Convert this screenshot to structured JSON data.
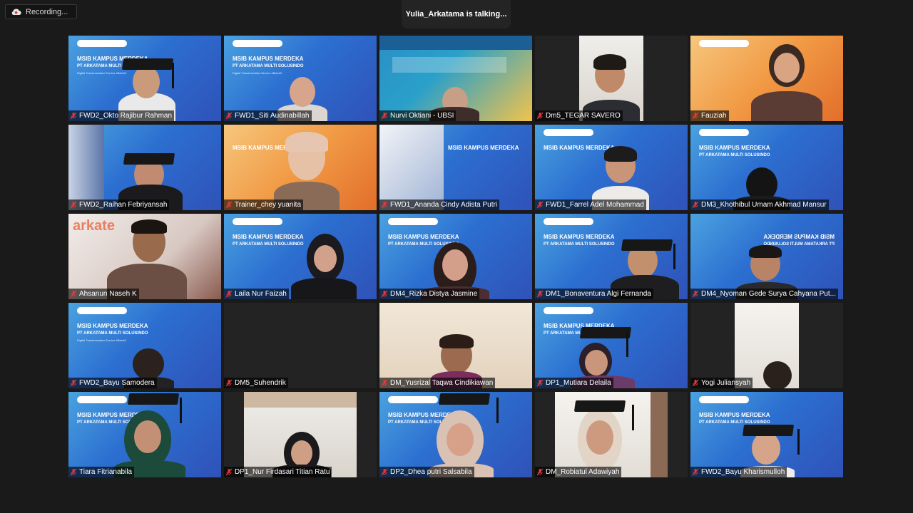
{
  "recording": {
    "label": "Recording..."
  },
  "active_speaker": {
    "text": "Yulia_Arkatama is talking..."
  },
  "colors": {
    "muted_mic": "#e8383d",
    "background": "#1a1a1a"
  },
  "slide": {
    "line1": "MSIB KAMPUS MERDEKA",
    "line2": "PT ARKATAMA MULTI SOLUSINDO",
    "line3": "Digital Transformation Service #Batch2"
  },
  "participants": [
    {
      "name": "FWD2_Okto Rajibur Rahman",
      "bg": "msib"
    },
    {
      "name": "FWD1_Siti Audinabillah",
      "bg": "msib"
    },
    {
      "name": "Nurvi Oktiani - UBSI",
      "bg": "teal"
    },
    {
      "name": "Dm5_TEGAR SAVERO",
      "bg": "dark"
    },
    {
      "name": "Fauziah",
      "bg": "orange"
    },
    {
      "name": "FWD2_Raihan Febriyansah",
      "bg": "msib"
    },
    {
      "name": "Trainer_chey yuanita",
      "bg": "orange"
    },
    {
      "name": "FWD1_Ananda Cindy Adista Putri",
      "bg": "msib"
    },
    {
      "name": "FWD1_Farrel Adel Mohammad",
      "bg": "msib"
    },
    {
      "name": "DM3_Khothibul Umam Akhmad Mansur",
      "bg": "msib"
    },
    {
      "name": "Ahsanun Naseh K",
      "bg": "office"
    },
    {
      "name": "Laila Nur Faizah",
      "bg": "msib"
    },
    {
      "name": "DM4_Rizka Distya Jasmine",
      "bg": "msib"
    },
    {
      "name": "DM1_Bonaventura Algi Fernanda",
      "bg": "msib"
    },
    {
      "name": "DM4_Nyoman Gede Surya Cahyana Put...",
      "bg": "msib"
    },
    {
      "name": "FWD2_Bayu Samodera",
      "bg": "msib"
    },
    {
      "name": "DM5_Suhendrik",
      "bg": "dark"
    },
    {
      "name": "DM_Yusrizal Taqwa Cindikiawan",
      "bg": "warm"
    },
    {
      "name": "DP1_Mutiara Delaila",
      "bg": "msib"
    },
    {
      "name": "Yogi Juliansyah",
      "bg": "dark"
    },
    {
      "name": "Tiara Fitrianabila",
      "bg": "msib"
    },
    {
      "name": "DP1_Nur Firdasari Titian Ratu",
      "bg": "dark"
    },
    {
      "name": "DP2_Dhea putri Salsabila",
      "bg": "msib"
    },
    {
      "name": "DM_Robiatul Adawiyah",
      "bg": "dark"
    },
    {
      "name": "FWD2_Bayu Kharismulloh",
      "bg": "msib"
    }
  ]
}
